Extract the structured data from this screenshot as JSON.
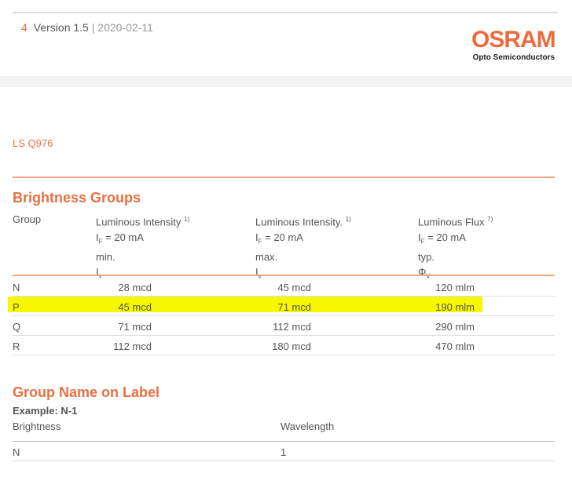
{
  "header": {
    "page_number": "4",
    "version": "Version 1.5",
    "separator": "|",
    "date": "2020-02-11"
  },
  "logo": {
    "brand": "OSRAM",
    "subtitle": "Opto Semiconductors"
  },
  "product": "LS Q976",
  "brightness": {
    "title": "Brightness Groups",
    "columns": [
      {
        "lines": [
          "Group"
        ]
      },
      {
        "title": "Luminous Intensity",
        "note": "1)",
        "cond": "= 20 mA",
        "cond_sym": "I",
        "cond_sub": "F",
        "stat": "min.",
        "sym": "I",
        "sym_sub": "v"
      },
      {
        "title": "Luminous Intensity.",
        "note": "1)",
        "cond": "= 20 mA",
        "cond_sym": "I",
        "cond_sub": "F",
        "stat": "max.",
        "sym": "I",
        "sym_sub": "v"
      },
      {
        "title": "Luminous Flux",
        "note": "7)",
        "cond": "= 20 mA",
        "cond_sym": "I",
        "cond_sub": "F",
        "stat": "typ.",
        "sym": "Φ",
        "sym_sub": "V"
      }
    ],
    "rows": [
      {
        "group": "N",
        "min": "28 mcd",
        "max": "45 mcd",
        "flux": "120 mlm"
      },
      {
        "group": "P",
        "min": "45 mcd",
        "max": "71 mcd",
        "flux": "190 mlm",
        "highlighted": true
      },
      {
        "group": "Q",
        "min": "71 mcd",
        "max": "112 mcd",
        "flux": "290 mlm"
      },
      {
        "group": "R",
        "min": "112 mcd",
        "max": "180 mcd",
        "flux": "470 mlm"
      }
    ],
    "highlight_color": "#f7f700"
  },
  "label": {
    "title": "Group Name on Label",
    "example": "Example: N-1",
    "col1": "Brightness",
    "col2": "Wavelength",
    "rows": [
      {
        "brightness": "N",
        "wavelength": "1"
      }
    ]
  }
}
